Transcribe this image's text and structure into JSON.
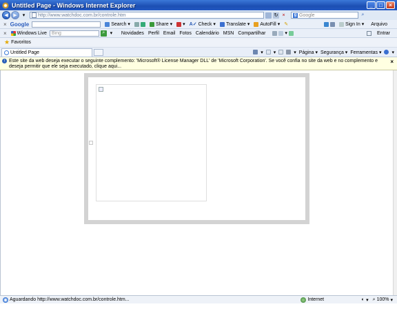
{
  "window": {
    "title": "Untitled Page - Windows Internet Explorer"
  },
  "address": {
    "url": "http://www.watchdoc.com.br/controle.htm"
  },
  "search": {
    "placeholder": "Google"
  },
  "google_toolbar": {
    "logo": "Google",
    "items": [
      "Search",
      "Share",
      "Check",
      "Translate",
      "AutoFill"
    ],
    "sign_in": "Sign In",
    "arquivo": "Arquivo"
  },
  "live_toolbar": {
    "brand": "Windows Live",
    "search_placeholder": "Bing",
    "links": [
      "Novidades",
      "Perfil",
      "Email",
      "Fotos",
      "Calendário",
      "MSN",
      "Compartilhar"
    ],
    "entrar": "Entrar"
  },
  "favorites": {
    "label": "Favoritos"
  },
  "tab": {
    "title": "Untitled Page"
  },
  "commands": [
    "Página",
    "Segurança",
    "Ferramentas"
  ],
  "infobar": {
    "message": "Este site da web deseja executar o seguinte complemento: 'Microsoft® License Manager DLL' de 'Microsoft Corporation'. Se você confia no site da web e no complemento e deseja permitir que ele seja executado, clique aqui..."
  },
  "status": {
    "text": "Aguardando http://www.watchdoc.com.br/controle.htm...",
    "zone": "Internet",
    "zoom": "100%"
  },
  "colors": {
    "title_bar": "#1c4fb3",
    "infobar": "#ffffe1",
    "frame_border": "#d3d3d3"
  }
}
